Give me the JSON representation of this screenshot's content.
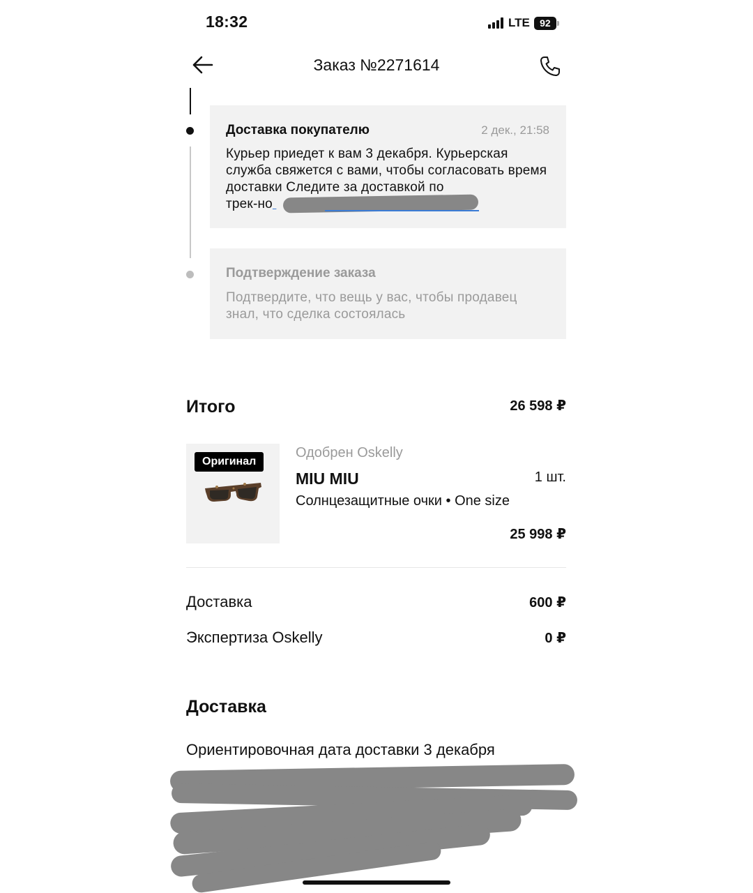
{
  "status_bar": {
    "time": "18:32",
    "network": "LTE",
    "battery": "92"
  },
  "header": {
    "title": "Заказ №2271614",
    "back_icon": "arrow-left-icon",
    "call_icon": "phone-icon"
  },
  "timeline": [
    {
      "title": "Доставка покупателю",
      "date": "2 дек., 21:58",
      "text": "Курьер приедет к вам 3 декабря. Курьерская служба свяжется с вами, чтобы согласовать время доставки Следите за доставкой по",
      "track_prefix": "трек-но",
      "active": true
    },
    {
      "title": "Подтверждение заказа",
      "text": "Подтвердите, что вещь у вас, чтобы продавец знал, что сделка состоялась",
      "active": false
    }
  ],
  "summary": {
    "title": "Итого",
    "total": "26 598 ₽",
    "product": {
      "badge": "Оригинал",
      "approved": "Одобрен Oskelly",
      "brand": "MIU MIU",
      "qty": "1 шт.",
      "desc": "Солнцезащитные очки • One size",
      "price": "25 998 ₽"
    },
    "delivery_label": "Доставка",
    "delivery_price": "600 ₽",
    "expertise_label": "Экспертиза Oskelly",
    "expertise_price": "0 ₽"
  },
  "delivery": {
    "title": "Доставка",
    "estimate": "Ориентировочная дата доставки 3 декабря"
  },
  "colors": {
    "accent_link": "#3a7bd5",
    "card_bg": "#f2f2f2",
    "muted": "#9a9a9a",
    "redaction": "#878787"
  }
}
